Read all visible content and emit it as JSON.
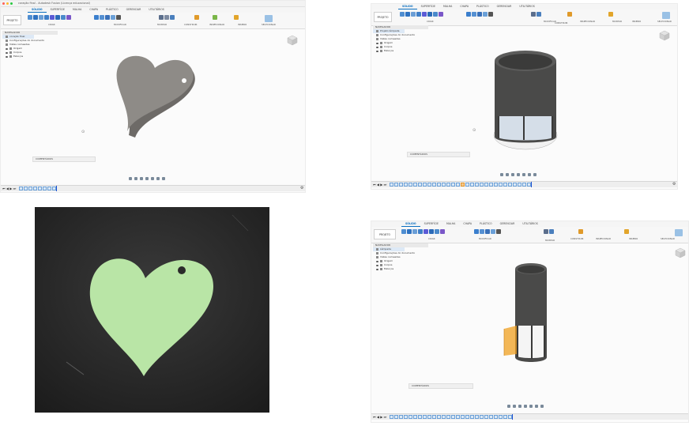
{
  "panel1": {
    "window_title": "coração final - Autodesk Fusion (Licença educacional)",
    "tabs": [
      "SÓLIDO",
      "SUPERFÍCIE",
      "MALHA",
      "CHAPA",
      "PLÁSTICO",
      "GERENCIAR",
      "UTILITÁRIOS"
    ],
    "project_button": "PROJETO",
    "groups": [
      "CRIAR",
      "MODIFICAR",
      "MONTAR",
      "CONSTRUIR",
      "INSPECIONAR",
      "INSERIR",
      "SELECIONAR"
    ],
    "navigator": {
      "header": "NAVEGADOR",
      "root": "coração final",
      "items": [
        "Configurações do documento",
        "Vistas nomeadas",
        "Origem",
        "Corpos",
        "Esboços"
      ]
    },
    "comments": "COMENTÁRIOS"
  },
  "panel2": {
    "tabs": [
      "SÓLIDO",
      "SUPERFÍCIE",
      "MALHA",
      "CHAPA",
      "PLÁSTICO",
      "GERENCIAR",
      "UTILITÁRIOS"
    ],
    "project_button": "PROJETO",
    "groups": [
      "CRIAR",
      "MODIFICAR",
      "MONTAR",
      "CONSTRUIR",
      "INSPECIONAR",
      "INSERIR",
      "SELECIONAR"
    ],
    "navigator": {
      "header": "NAVEGADOR",
      "root": "Projeto lâmpada",
      "items": [
        "Configurações do documento",
        "Vistas nomeadas",
        "Origem",
        "Corpos",
        "Esboços"
      ]
    },
    "comments": "COMENTÁRIOS"
  },
  "panel3": {
    "tabs": [
      "SÓLIDO",
      "SUPERFÍCIE",
      "MALHA",
      "CHAPA",
      "PLÁSTICO",
      "GERENCIAR",
      "UTILITÁRIOS"
    ],
    "project_button": "PROJETO",
    "groups": [
      "CRIAR",
      "MODIFICAR",
      "MONTAR",
      "CONSTRUIR",
      "INSPECIONAR",
      "INSERIR",
      "SELECIONAR"
    ],
    "navigator": {
      "header": "NAVEGADOR",
      "root": "Lâmpada",
      "items": [
        "Configurações do documento",
        "Vistas nomeadas",
        "Origem",
        "Corpos",
        "Esboços"
      ]
    },
    "comments": "COMENTÁRIOS"
  },
  "colors": {
    "accent": "#0b6fc0",
    "model_gray": "#8e8b87",
    "cylinder_dark": "#4a4a49",
    "photo_heart": "#b9e5a6",
    "photo_bg": "#2a2a2a",
    "selection_orange": "#f0a020"
  }
}
